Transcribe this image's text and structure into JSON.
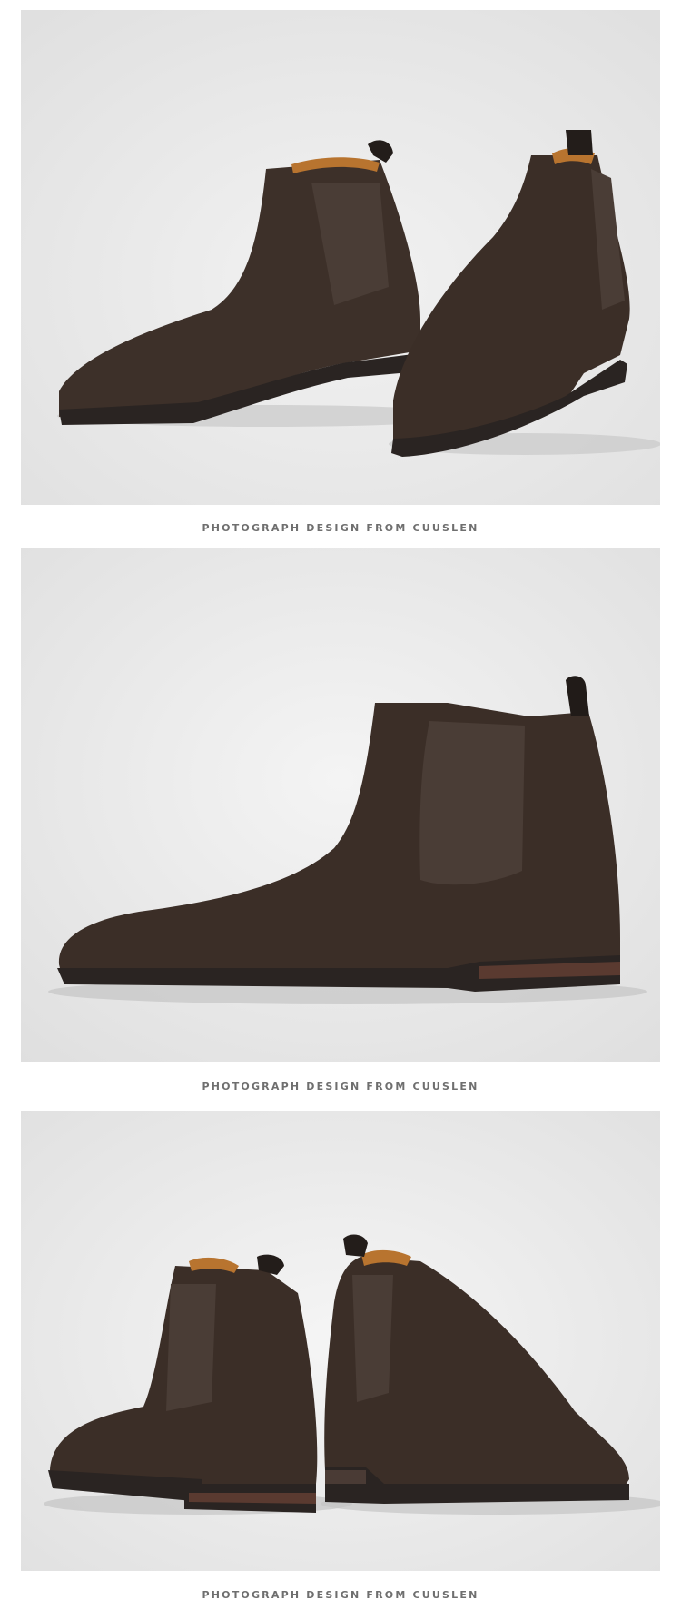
{
  "sections": [
    {
      "photo": {
        "subject": "pair of dark brown suede chelsea boots, front three-quarter view"
      },
      "caption": "PHOTOGRAPH DESIGN FROM CUUSLEN"
    },
    {
      "photo": {
        "subject": "single dark brown suede chelsea boot, side profile"
      },
      "caption": "PHOTOGRAPH DESIGN FROM CUUSLEN"
    },
    {
      "photo": {
        "subject": "pair of dark brown suede chelsea boots, rear view"
      },
      "caption": "PHOTOGRAPH DESIGN FROM CUUSLEN"
    }
  ],
  "colors": {
    "suede": "#3b2e27",
    "elastic": "#4a3d36",
    "sole": "#2a2422",
    "lining": "#b8742f",
    "backdrop": "#e8e8e8"
  }
}
